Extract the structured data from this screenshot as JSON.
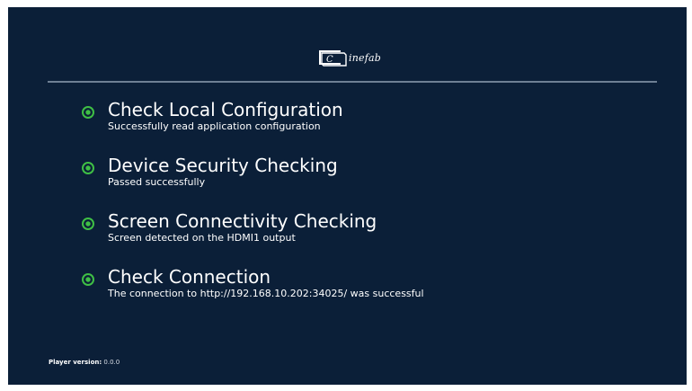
{
  "logo": {
    "mark_text": "C",
    "text": "inefab"
  },
  "checks": [
    {
      "title": "Check Local Configuration",
      "detail": "Successfully read application configuration",
      "status": "success"
    },
    {
      "title": "Device Security Checking",
      "detail": "Passed successfully",
      "status": "success"
    },
    {
      "title": "Screen Connectivity Checking",
      "detail": "Screen detected on the HDMI1 output",
      "status": "success"
    },
    {
      "title": "Check Connection",
      "detail": "The connection to http://192.168.10.202:34025/ was successful",
      "status": "success"
    }
  ],
  "footer": {
    "version_label": "Player version:",
    "version_value": "0.0.0"
  },
  "colors": {
    "background": "#0b1f38",
    "divider": "#6e7f94",
    "success": "#3fbf45",
    "text": "#ffffff"
  },
  "icons": {
    "status": "radio-check-icon"
  }
}
